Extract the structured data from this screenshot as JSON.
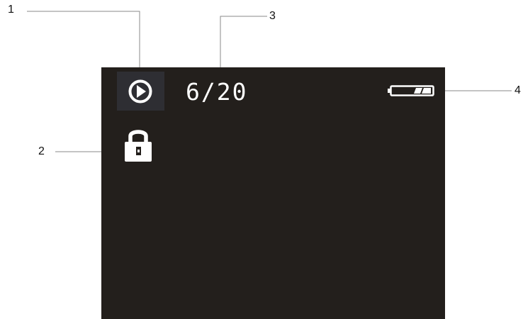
{
  "callouts": {
    "one": "1",
    "two": "2",
    "three": "3",
    "four": "4"
  },
  "screen": {
    "counter": "6/20",
    "icons": {
      "playback": "play-icon",
      "protect": "lock-icon",
      "battery": "battery-icon"
    },
    "battery_level_fraction": 0.67
  },
  "colors": {
    "screen_background": "#231f1c",
    "icon_highlight": "#2e2e33",
    "foreground": "#ffffff",
    "leader_lines": "#8a8a8a"
  }
}
